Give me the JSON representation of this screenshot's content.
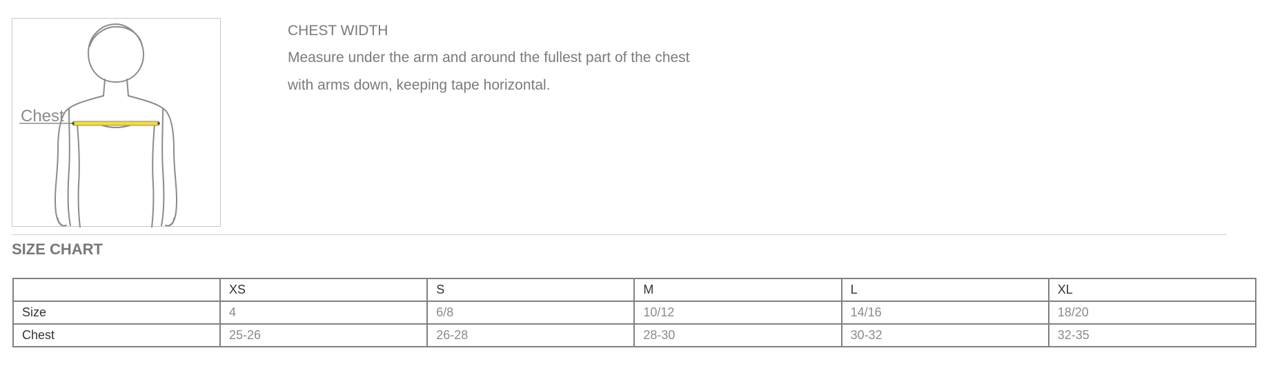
{
  "figure": {
    "chest_label": "Chest",
    "tape_color": "#f2dc3c",
    "outline_color": "#8a8a8a"
  },
  "measurement": {
    "title": "CHEST WIDTH",
    "line1": "Measure under the arm and around the fullest part of the chest",
    "line2": "with arms down, keeping tape horizontal."
  },
  "size_chart": {
    "title": "SIZE CHART",
    "columns": [
      "",
      "XS",
      "S",
      "M",
      "L",
      "XL"
    ],
    "rows": [
      {
        "label": "Size",
        "values": [
          "4",
          "6/8",
          "10/12",
          "14/16",
          "18/20"
        ]
      },
      {
        "label": "Chest",
        "values": [
          "25-26",
          "26-28",
          "28-30",
          "30-32",
          "32-35"
        ]
      }
    ]
  }
}
